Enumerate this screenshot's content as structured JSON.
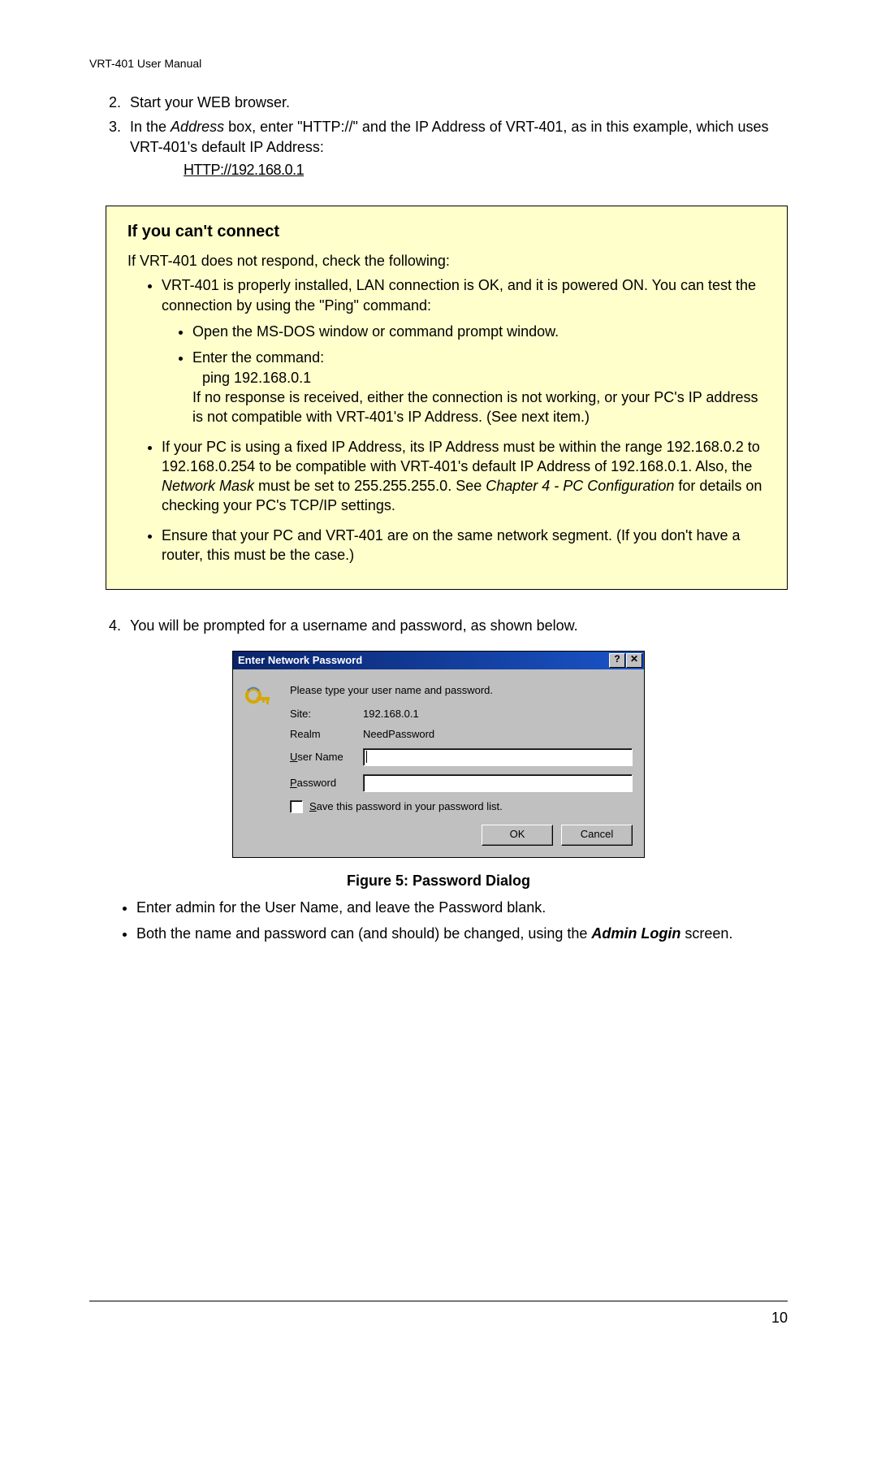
{
  "header": "VRT-401 User Manual",
  "steps": {
    "s2": "Start your WEB browser.",
    "s3_a": "In the ",
    "s3_address_label": "Address",
    "s3_b": " box, enter \"HTTP://\" and the IP Address of VRT-401, as in this example, which uses VRT-401's default IP Address:",
    "s3_url": "HTTP://192.168.0.1",
    "s4": "You will be prompted for a username and password, as shown below."
  },
  "note": {
    "title": "If you can't connect",
    "intro": "If VRT-401 does not respond, check the following:",
    "i1": "VRT-401 is properly installed, LAN connection is OK, and it is powered ON. You can test the connection by using the \"Ping\" command:",
    "i1a": "Open the MS-DOS window or command prompt window.",
    "i1b_line1": "Enter the command:",
    "i1b_cmd": "ping 192.168.0.1",
    "i1b_line2": "If no response is received, either the connection is not working, or your PC's IP address is not compatible with VRT-401's IP Address. (See next item.)",
    "i2_a": "If your PC is using a fixed IP Address, its IP Address must be within the range 192.168.0.2 to 192.168.0.254 to be compatible with VRT-401's default IP Address of 192.168.0.1. Also, the ",
    "i2_nm": "Network Mask",
    "i2_b": " must be set to 255.255.255.0. See ",
    "i2_chap": "Chapter 4 - PC Configuration",
    "i2_c": " for details on checking your PC's TCP/IP settings.",
    "i3": "Ensure that your PC and VRT-401 are on the same network segment. (If you don't have a router, this must be the case.)"
  },
  "dialog": {
    "title": "Enter Network Password",
    "help": "?",
    "close": "✕",
    "prompt": "Please type your user name and password.",
    "site_label": "Site:",
    "site_value": "192.168.0.1",
    "realm_label": "Realm",
    "realm_value": "NeedPassword",
    "user_label_u": "U",
    "user_label_rest": "ser Name",
    "pass_label_u": "P",
    "pass_label_rest": "assword",
    "save_u": "S",
    "save_rest": "ave this password in your password list.",
    "ok": "OK",
    "cancel": "Cancel"
  },
  "figure_caption": "Figure 5: Password Dialog",
  "post": {
    "b1": "Enter admin for the User Name, and leave the Password blank.",
    "b2_a": "Both the name and password can (and should) be changed, using the ",
    "b2_admin": "Admin Login",
    "b2_b": " screen."
  },
  "page_number": "10"
}
